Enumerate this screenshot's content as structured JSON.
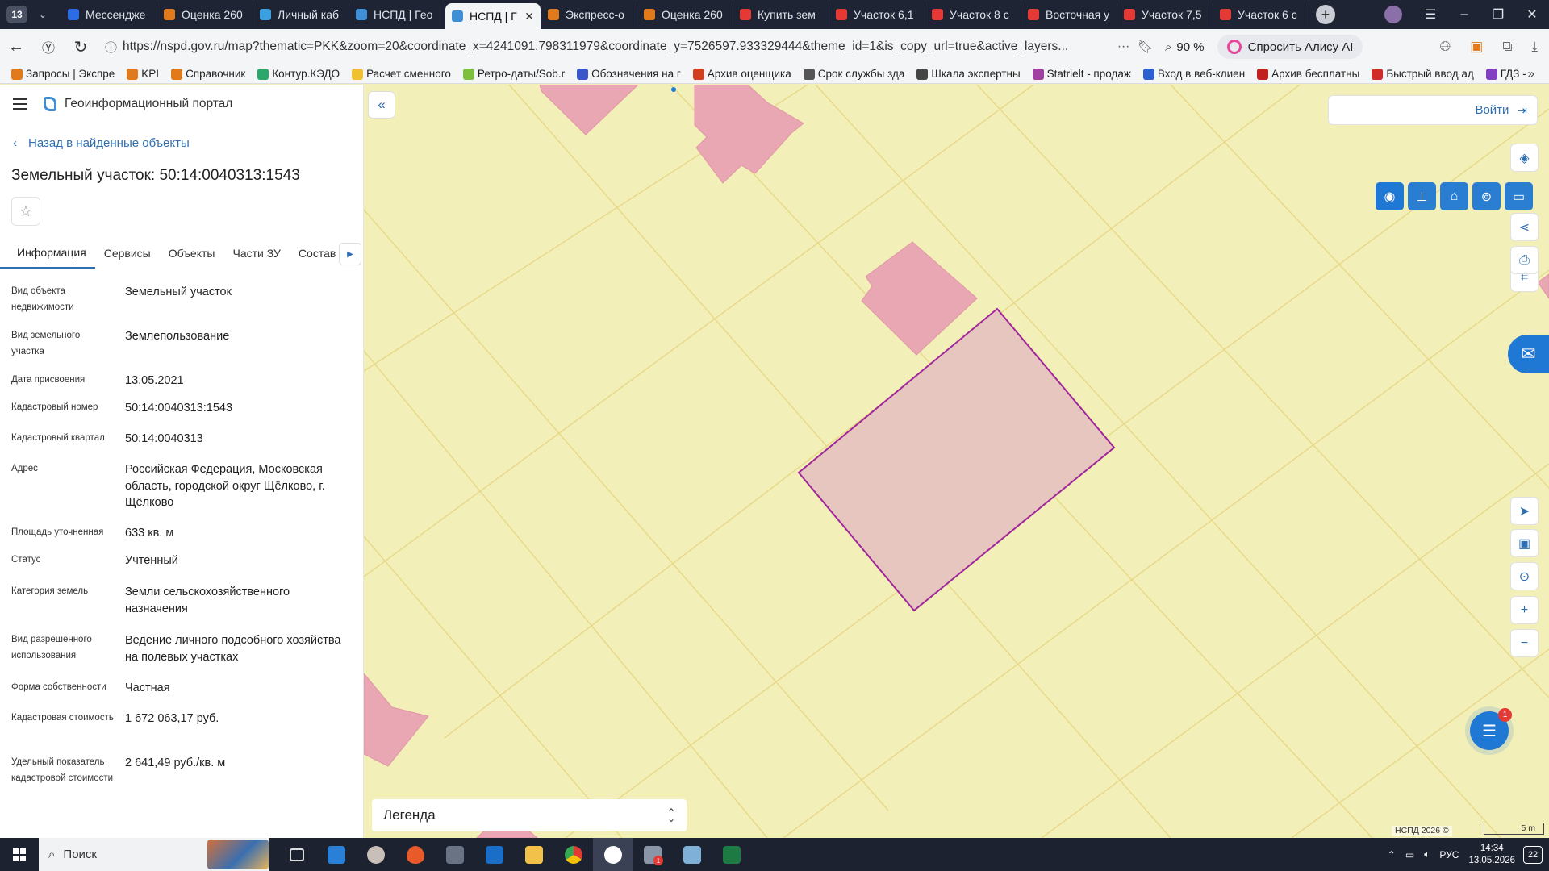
{
  "browser": {
    "tab_count": "13",
    "tabs": [
      {
        "label": "Мессендже",
        "color": "#2b6de5"
      },
      {
        "label": "Оценка 260",
        "color": "#e07a1a"
      },
      {
        "label": "Личный каб",
        "color": "#3aa0e0"
      },
      {
        "label": "НСПД | Гео",
        "color": "#3f8fd6"
      },
      {
        "label": "НСПД | Г",
        "color": "#3f8fd6",
        "active": true
      },
      {
        "label": "Экспресс-о",
        "color": "#e07a1a"
      },
      {
        "label": "Оценка 260",
        "color": "#e07a1a"
      },
      {
        "label": "Купить зем",
        "color": "#e53935"
      },
      {
        "label": "Участок 6,1",
        "color": "#e53935"
      },
      {
        "label": "Участок 8 с",
        "color": "#e53935"
      },
      {
        "label": "Восточная у",
        "color": "#e53935"
      },
      {
        "label": "Участок 7,5",
        "color": "#e53935"
      },
      {
        "label": "Участок 6 с",
        "color": "#e53935"
      }
    ],
    "url": "https://nspd.gov.ru/map?thematic=PKK&zoom=20&coordinate_x=4241091.798311979&coordinate_y=7526597.933329444&theme_id=1&is_copy_url=true&active_layers...",
    "zoom": "90 %",
    "alice_label": "Спросить Алису AI",
    "bookmarks": [
      {
        "label": "Запросы | Экспре",
        "color": "#e07a1a"
      },
      {
        "label": "KPI",
        "color": "#e07a1a"
      },
      {
        "label": "Справочник",
        "color": "#e07a1a"
      },
      {
        "label": "Контур.КЭДО",
        "color": "#2aa86b"
      },
      {
        "label": "Расчет сменного",
        "color": "#f0c030"
      },
      {
        "label": "Ретро-даты/Sob.r",
        "color": "#7fbf3f"
      },
      {
        "label": "Обозначения на г",
        "color": "#3a56c8"
      },
      {
        "label": "Архив оценщика",
        "color": "#d04020"
      },
      {
        "label": "Срок службы зда",
        "color": "#555555"
      },
      {
        "label": "Шкала экспертны",
        "color": "#444444"
      },
      {
        "label": "Statrielt - продаж",
        "color": "#a040a0"
      },
      {
        "label": "Вход в веб-клиен",
        "color": "#2a60d0"
      },
      {
        "label": "Архив бесплатны",
        "color": "#c02020"
      },
      {
        "label": "Быстрый ввод ад",
        "color": "#d02a2a"
      },
      {
        "label": "ГДЗ -",
        "color": "#8040c0"
      }
    ]
  },
  "portal": {
    "title": "Геоинформационный портал",
    "back_label": "Назад в найденные объекты",
    "object_title": "Земельный участок: 50:14:0040313:1543",
    "tabs": [
      "Информация",
      "Сервисы",
      "Объекты",
      "Части ЗУ",
      "Состав"
    ],
    "properties": [
      {
        "key": "Вид объекта недвижимости",
        "value": "Земельный участок"
      },
      {
        "key": "Вид земельного участка",
        "value": "Землепользование"
      },
      {
        "key": "Дата присвоения",
        "value": "13.05.2021"
      },
      {
        "key": "Кадастровый номер",
        "value": "50:14:0040313:1543"
      },
      {
        "key": "Кадастровый квартал",
        "value": "50:14:0040313"
      },
      {
        "key": "Адрес",
        "value": "Российская Федерация, Московская область, городской округ Щёлково, г. Щёлково"
      },
      {
        "key": "Площадь уточненная",
        "value": "633 кв. м"
      },
      {
        "key": "Статус",
        "value": "Учтенный"
      },
      {
        "key": "Категория земель",
        "value": "Земли сельскохозяйственного назначения"
      },
      {
        "key": "Вид разрешенного использования",
        "value": "Ведение личного подсобного хозяйства на полевых участках"
      },
      {
        "key": "Форма собственности",
        "value": "Частная"
      },
      {
        "key": "Кадастровая стоимость",
        "value": "1 672 063,17 руб."
      },
      {
        "key": "Удельный показатель кадастровой стоимости",
        "value": "2 641,49 руб./кв. м"
      }
    ]
  },
  "map": {
    "login_label": "Войти",
    "legend_label": "Легенда",
    "copyright": "НСПД 2026 ©",
    "scale_label": "5 m",
    "chat_badge": "1",
    "colors": {
      "background": "#f3efb8",
      "parcel_line": "#e8d98a",
      "building": "#e8a7b3",
      "selected_outline": "#a0259a",
      "accent": "#1f78d4"
    }
  },
  "taskbar": {
    "search_label": "Поиск",
    "lang": "РУС",
    "time": "14:34",
    "date": "13.05.2026",
    "notifications": "22",
    "app_badge": "1"
  }
}
